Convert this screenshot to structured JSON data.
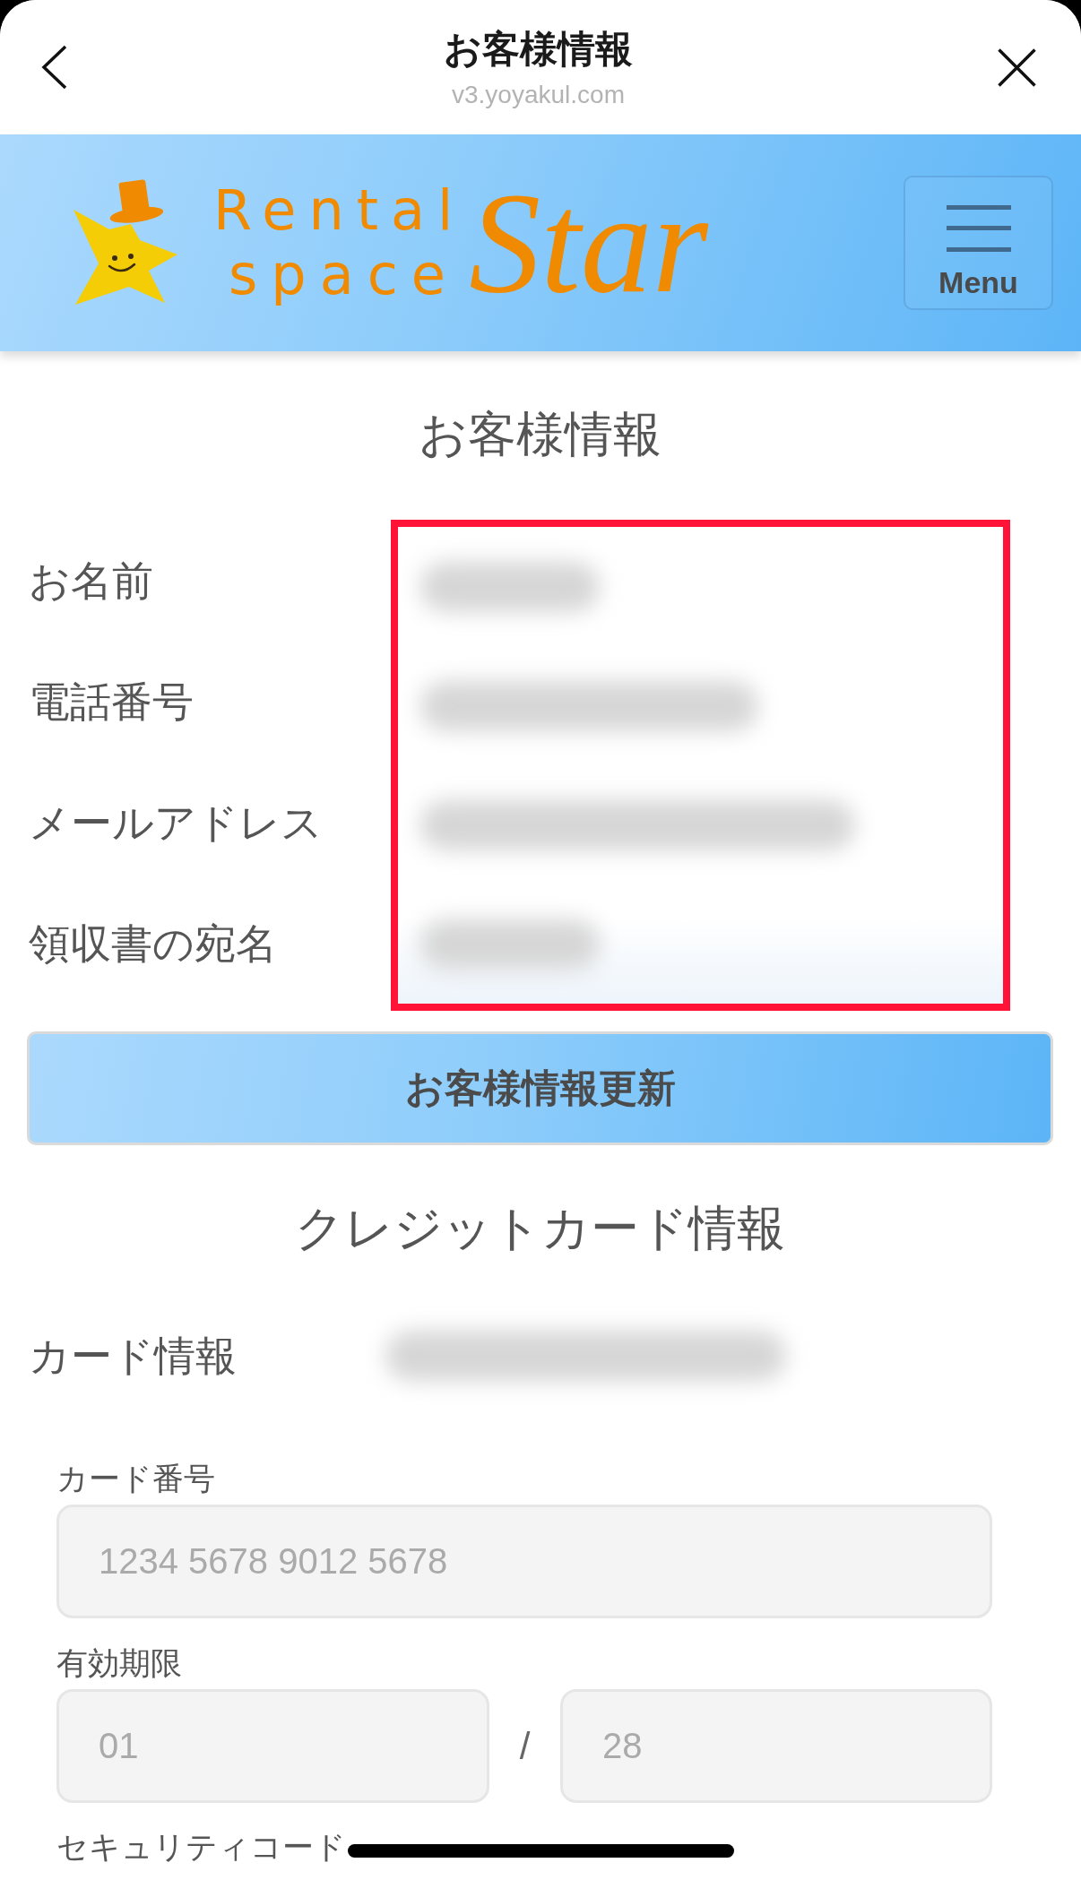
{
  "nav_bar": {
    "title": "お客様情報",
    "url": "v3.yoyakul.com"
  },
  "header": {
    "logo": {
      "line_1": "Rental",
      "line_2": "space",
      "word": "Star"
    },
    "menu_button": {
      "label": "Menu"
    }
  },
  "customer_info": {
    "heading": "お客様情報",
    "highlighted": true,
    "rows": [
      {
        "label": "お名前",
        "redacted": true
      },
      {
        "label": "電話番号",
        "redacted": true
      },
      {
        "label": "メールアドレス",
        "redacted": true
      },
      {
        "label": "領収書の宛名",
        "redacted": true
      }
    ]
  },
  "update_button": {
    "label": "お客様情報更新"
  },
  "credit_card": {
    "heading": "クレジットカード情報",
    "card_info": {
      "label": "カード情報",
      "redacted": true
    },
    "card_number": {
      "label": "カード番号",
      "placeholder": "1234 5678 9012 5678"
    },
    "expiry": {
      "label": "有効期限",
      "month": {
        "placeholder": "01"
      },
      "separator": "/",
      "year": {
        "placeholder": "28"
      }
    },
    "security_code": {
      "label": "セキュリティコード"
    }
  }
}
